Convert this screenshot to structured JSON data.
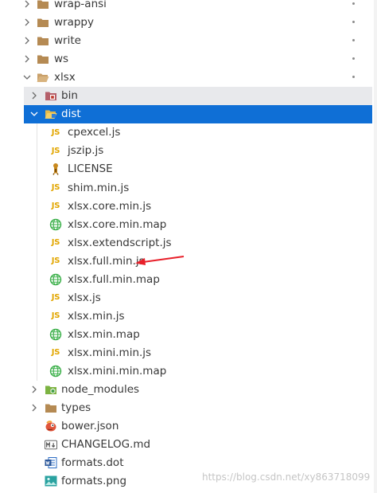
{
  "tree": [
    {
      "label": "wrap-ansi",
      "icon": "folder-icon",
      "chevron": "right",
      "depth": 0,
      "dot": true
    },
    {
      "label": "wrappy",
      "icon": "folder-icon",
      "chevron": "right",
      "depth": 0,
      "dot": true
    },
    {
      "label": "write",
      "icon": "folder-icon",
      "chevron": "right",
      "depth": 0,
      "dot": true
    },
    {
      "label": "ws",
      "icon": "folder-icon",
      "chevron": "right",
      "depth": 0,
      "dot": true
    },
    {
      "label": "xlsx",
      "icon": "folder-open-icon",
      "chevron": "down",
      "depth": 0,
      "dot": true
    },
    {
      "label": "bin",
      "icon": "bin-folder-icon",
      "chevron": "right",
      "depth": 1,
      "dot": false,
      "state": "hover"
    },
    {
      "label": "dist",
      "icon": "dist-folder-open-icon",
      "chevron": "down",
      "depth": 1,
      "dot": false,
      "state": "selected"
    },
    {
      "label": "cpexcel.js",
      "icon": "js-file-icon",
      "depth": 2
    },
    {
      "label": "jszip.js",
      "icon": "js-file-icon",
      "depth": 2
    },
    {
      "label": "LICENSE",
      "icon": "license-icon",
      "depth": 2
    },
    {
      "label": "shim.min.js",
      "icon": "js-file-icon",
      "depth": 2
    },
    {
      "label": "xlsx.core.min.js",
      "icon": "js-file-icon",
      "depth": 2
    },
    {
      "label": "xlsx.core.min.map",
      "icon": "globe-map-icon",
      "depth": 2
    },
    {
      "label": "xlsx.extendscript.js",
      "icon": "js-file-icon",
      "depth": 2
    },
    {
      "label": "xlsx.full.min.js",
      "icon": "js-file-icon",
      "depth": 2,
      "arrow": true
    },
    {
      "label": "xlsx.full.min.map",
      "icon": "globe-map-icon",
      "depth": 2
    },
    {
      "label": "xlsx.js",
      "icon": "js-file-icon",
      "depth": 2
    },
    {
      "label": "xlsx.min.js",
      "icon": "js-file-icon",
      "depth": 2
    },
    {
      "label": "xlsx.min.map",
      "icon": "globe-map-icon",
      "depth": 2
    },
    {
      "label": "xlsx.mini.min.js",
      "icon": "js-file-icon",
      "depth": 2
    },
    {
      "label": "xlsx.mini.min.map",
      "icon": "globe-map-icon",
      "depth": 2
    },
    {
      "label": "node_modules",
      "icon": "node-modules-folder-icon",
      "chevron": "right",
      "depth": 1
    },
    {
      "label": "types",
      "icon": "folder-icon",
      "chevron": "right",
      "depth": 1
    },
    {
      "label": "bower.json",
      "icon": "bower-icon",
      "depth": 1
    },
    {
      "label": "CHANGELOG.md",
      "icon": "markdown-icon",
      "depth": 1
    },
    {
      "label": "formats.dot",
      "icon": "word-doc-icon",
      "depth": 1
    },
    {
      "label": "formats.png",
      "icon": "image-icon",
      "depth": 1
    }
  ],
  "watermark": "https://blog.csdn.net/xy863718099",
  "colors": {
    "selected_bg": "#0f6fd6",
    "hover_bg": "#e8e9ec",
    "js_icon": "#e2a600",
    "folder": "#b58a53",
    "map_icon": "#3cb04a",
    "annotation_arrow": "#e8202a"
  }
}
